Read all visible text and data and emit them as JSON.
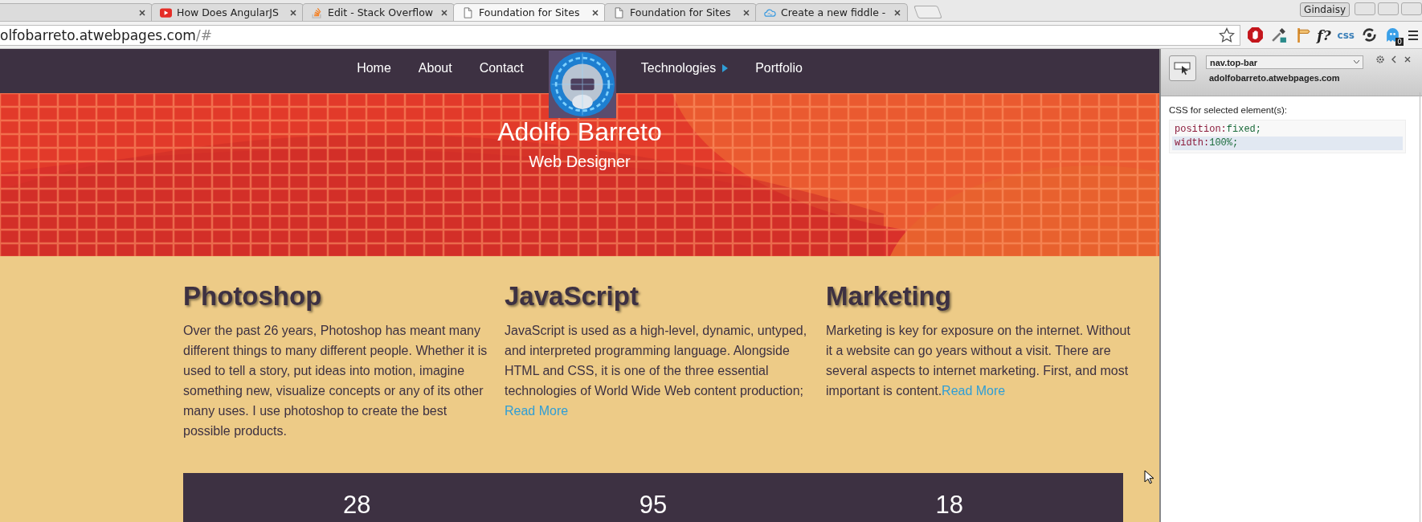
{
  "browser": {
    "tabs": [
      {
        "kind": "cut",
        "selected": false
      },
      {
        "kind": "video",
        "label": "How Does AngularJS",
        "selected": false
      },
      {
        "kind": "edit",
        "label": "Edit - Stack Overflow",
        "selected": false
      },
      {
        "kind": "page",
        "label": "Foundation for Sites",
        "selected": true
      },
      {
        "kind": "page",
        "label": "Foundation for Sites",
        "selected": false
      },
      {
        "kind": "fiddle",
        "label": "Create a new fiddle -",
        "selected": false
      }
    ],
    "profile": "Gindaisy",
    "address": {
      "host": "olfobarreto.atwebpages.com",
      "path": "/#"
    },
    "extensions": [
      {
        "kind": "stop"
      },
      {
        "kind": "dropper"
      },
      {
        "kind": "sign"
      },
      {
        "kind": "text",
        "label": "f?"
      },
      {
        "kind": "text",
        "label": "css"
      },
      {
        "kind": "sync"
      },
      {
        "kind": "ghost",
        "badge": "0"
      }
    ]
  },
  "nav": {
    "left": [
      {
        "label": "Home",
        "dropdown": false
      },
      {
        "label": "About",
        "dropdown": false
      },
      {
        "label": "Contact",
        "dropdown": false
      }
    ],
    "right": [
      {
        "label": "Technologies",
        "dropdown": true
      },
      {
        "label": "Portfolio",
        "dropdown": false
      }
    ]
  },
  "hero": {
    "title": "Adolfo Barreto",
    "subtitle": "Web Designer"
  },
  "columns": [
    {
      "title": "Photoshop",
      "text": "Over the past 26 years, Photoshop has meant many different things to many different people. Whether it is used to tell a story, put ideas into motion, imagine something new, visualize concepts or any of its other many uses. I use photoshop to create the best possible products."
    },
    {
      "title": "JavaScript",
      "text": "JavaScript is used as a high-level, dynamic, untyped, and interpreted programming language. Alongside HTML and CSS, it is one of the three essential technologies of World Wide Web content production; ",
      "link": "Read More"
    },
    {
      "title": "Marketing",
      "text": "Marketing is key for exposure on the internet. Without it a website can go years without a visit. There are several aspects to internet marketing. First, and most important is content.",
      "link": "Read More"
    }
  ],
  "stats": [
    "28",
    "95",
    "18"
  ],
  "devtools": {
    "selector": "nav.top-bar",
    "host": "adolfobarreto.atwebpages.com",
    "heading": "CSS for selected element(s):",
    "rules": [
      {
        "property": "position:",
        "value": "fixed;",
        "selected": false
      },
      {
        "property": "width:",
        "value": "100%;",
        "selected": true
      }
    ]
  }
}
